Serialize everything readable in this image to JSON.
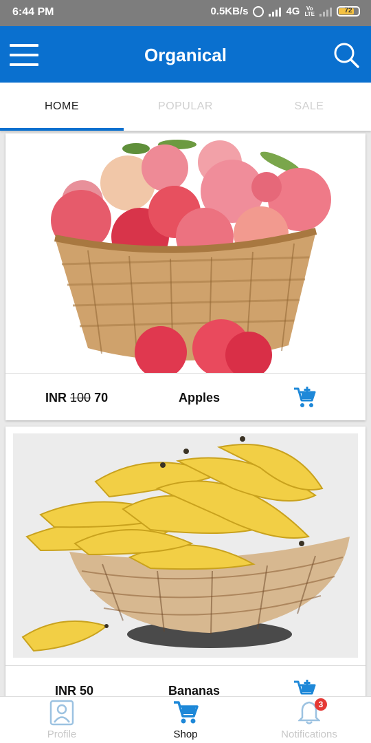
{
  "status": {
    "time": "6:44 PM",
    "speed": "0.5KB/s",
    "network": "4G",
    "volte_top": "Vo",
    "volte_bottom": "LTE",
    "battery": "72",
    "battery_level": 0.72
  },
  "appbar": {
    "title": "Organical",
    "menu_icon": "hamburger-menu-icon",
    "search_icon": "search-icon",
    "color": "#0a70cf"
  },
  "tabs": [
    {
      "label": "HOME",
      "active": true
    },
    {
      "label": "POPULAR",
      "active": false
    },
    {
      "label": "SALE",
      "active": false
    }
  ],
  "products": [
    {
      "name": "Apples",
      "currency": "INR",
      "old_price": "100",
      "price": "70",
      "image": "apples-in-basket",
      "cart_icon": "add-to-cart-icon"
    },
    {
      "name": "Bananas",
      "currency": "INR",
      "price": "50",
      "image": "bananas-in-basket",
      "cart_icon": "add-to-cart-icon"
    }
  ],
  "bottom_nav": [
    {
      "label": "Profile",
      "icon": "profile-icon",
      "active": false
    },
    {
      "label": "Shop",
      "icon": "shopping-cart-icon",
      "active": true
    },
    {
      "label": "Notifications",
      "icon": "bell-icon",
      "active": false,
      "badge": "3"
    }
  ],
  "colors": {
    "accent": "#0a70cf",
    "badge": "#e53935",
    "status_bar": "#7d7d7d"
  }
}
